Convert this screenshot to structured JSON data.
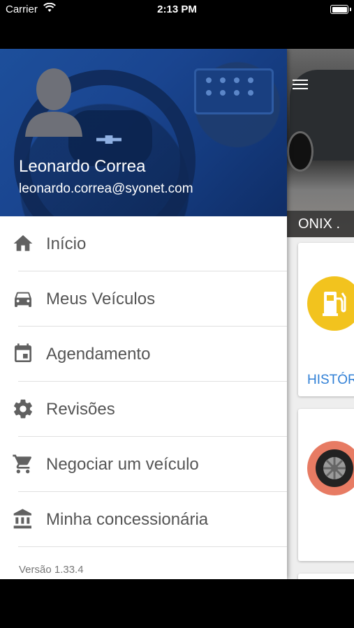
{
  "status_bar": {
    "carrier": "Carrier",
    "time": "2:13 PM"
  },
  "drawer": {
    "user_name": "Leonardo Correa",
    "user_email": "leonardo.correa@syonet.com",
    "menu": [
      {
        "label": "Início",
        "icon": "home-icon"
      },
      {
        "label": "Meus Veículos",
        "icon": "car-icon"
      },
      {
        "label": "Agendamento",
        "icon": "calendar-icon"
      },
      {
        "label": "Revisões",
        "icon": "gear-icon"
      },
      {
        "label": "Negociar um veículo",
        "icon": "cart-icon"
      },
      {
        "label": "Minha concessionária",
        "icon": "bank-icon"
      }
    ],
    "version": "Versão 1.33.4"
  },
  "main": {
    "vehicle_title": "ONIX .",
    "fuel_card_link": "HISTÓR"
  },
  "colors": {
    "header_blue": "#1a4590",
    "icon_gray": "#616161",
    "link_blue": "#2f7fd6",
    "fuel_yellow": "#f2c31e",
    "tire_red": "#e77b63"
  }
}
